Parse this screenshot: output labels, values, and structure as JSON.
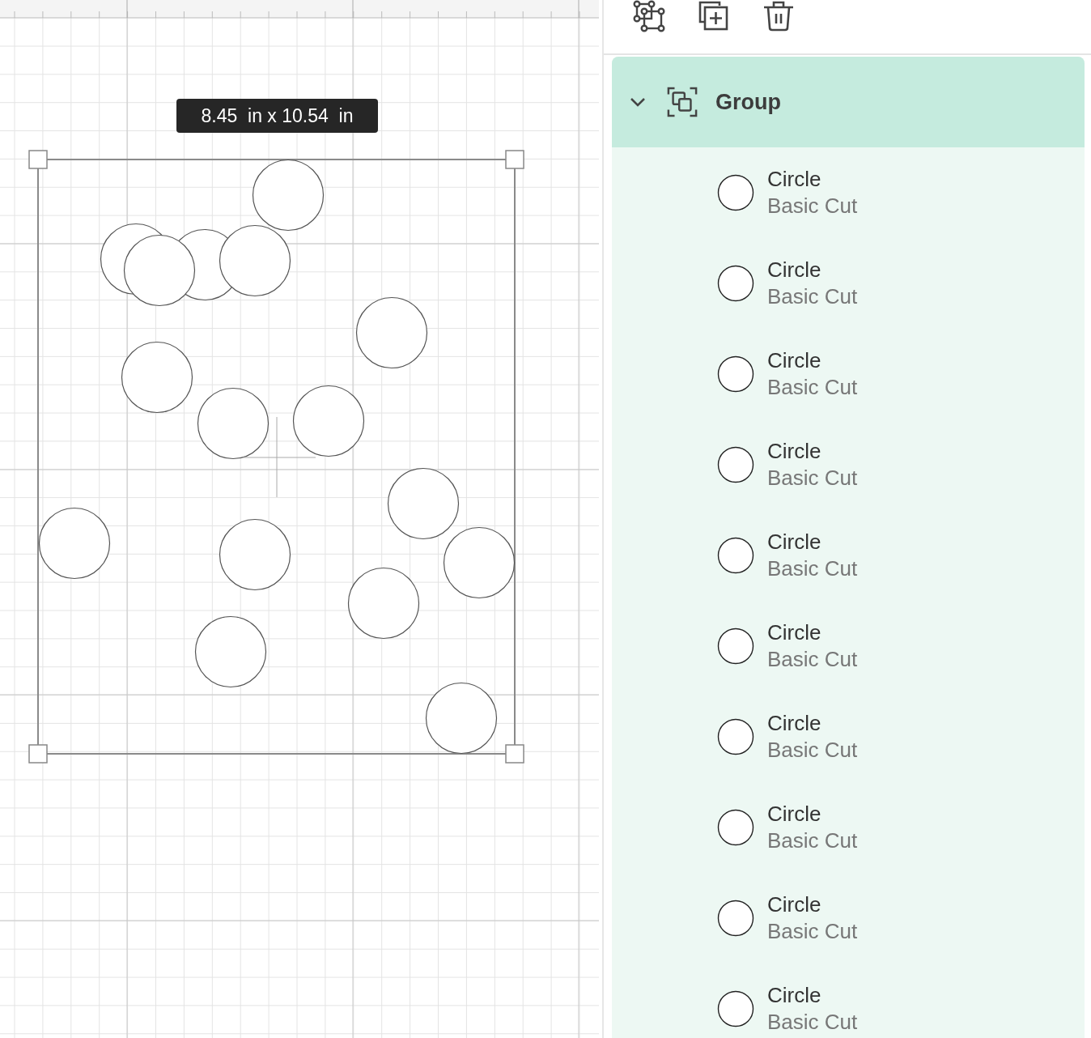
{
  "canvas": {
    "size_tooltip": "8.45  in x 10.54  in"
  },
  "layers_panel": {
    "group": {
      "label": "Group",
      "expanded": true
    },
    "items": [
      {
        "name": "Circle",
        "operation": "Basic Cut"
      },
      {
        "name": "Circle",
        "operation": "Basic Cut"
      },
      {
        "name": "Circle",
        "operation": "Basic Cut"
      },
      {
        "name": "Circle",
        "operation": "Basic Cut"
      },
      {
        "name": "Circle",
        "operation": "Basic Cut"
      },
      {
        "name": "Circle",
        "operation": "Basic Cut"
      },
      {
        "name": "Circle",
        "operation": "Basic Cut"
      },
      {
        "name": "Circle",
        "operation": "Basic Cut"
      },
      {
        "name": "Circle",
        "operation": "Basic Cut"
      },
      {
        "name": "Circle",
        "operation": "Basic Cut"
      }
    ]
  }
}
